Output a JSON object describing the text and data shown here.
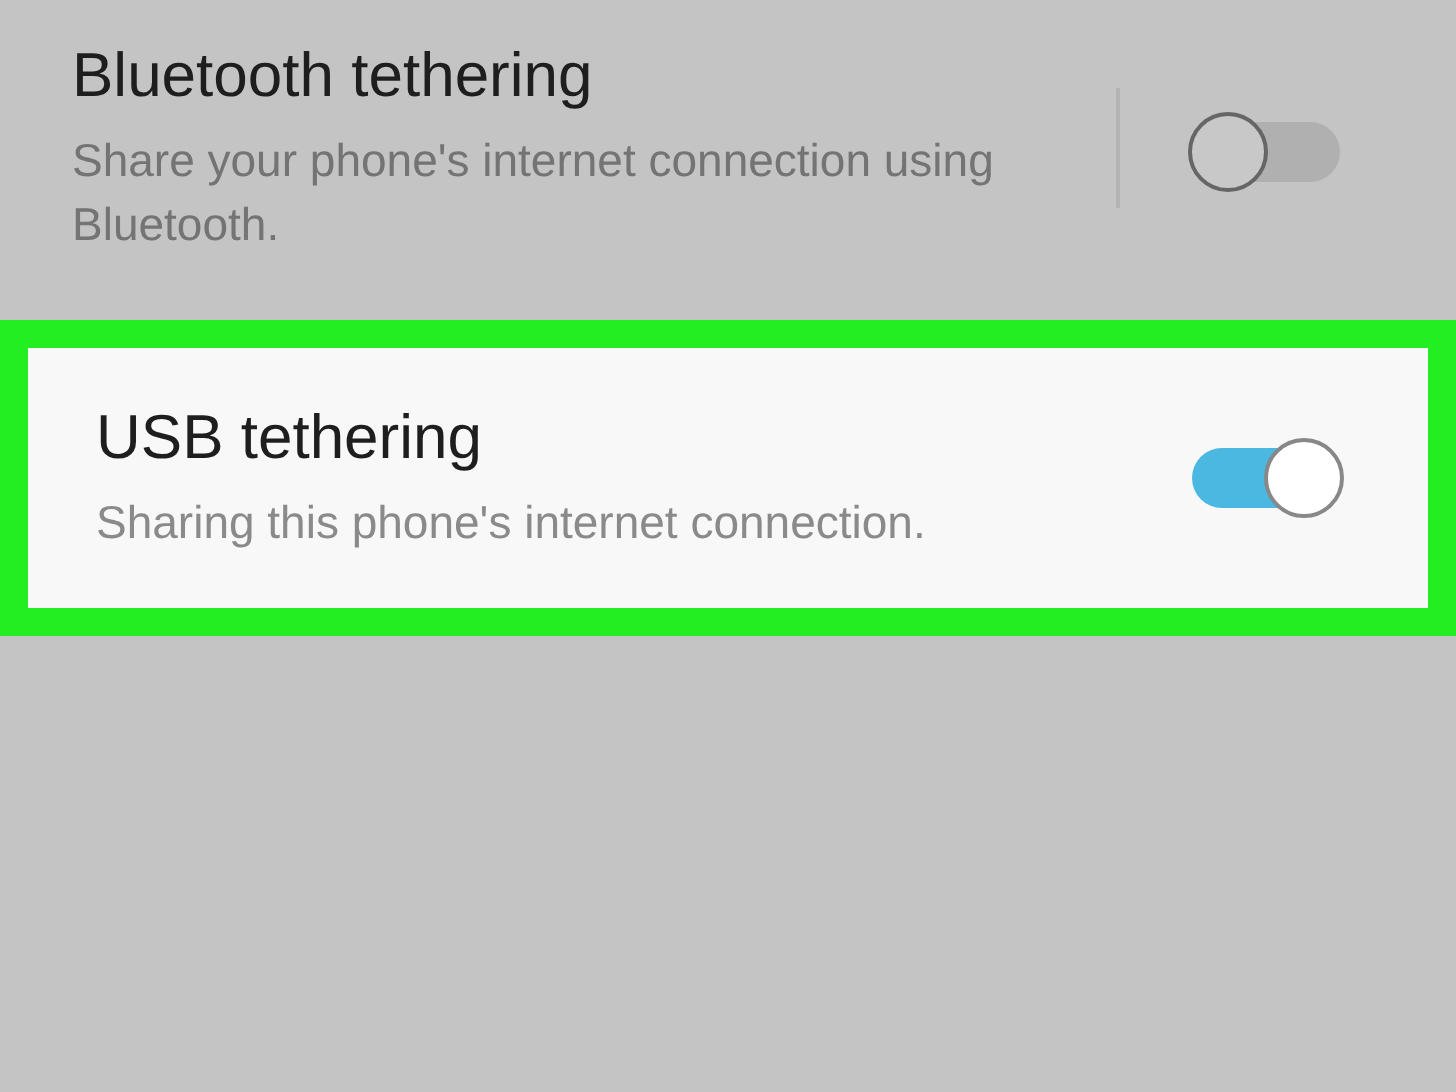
{
  "settings": [
    {
      "title": "Bluetooth tethering",
      "summary": "Share your phone's internet connection using Bluetooth.",
      "on": false,
      "divider": true,
      "highlighted": false
    },
    {
      "title": "USB tethering",
      "summary": "Sharing this phone's internet connection.",
      "on": true,
      "divider": false,
      "highlighted": true
    }
  ]
}
